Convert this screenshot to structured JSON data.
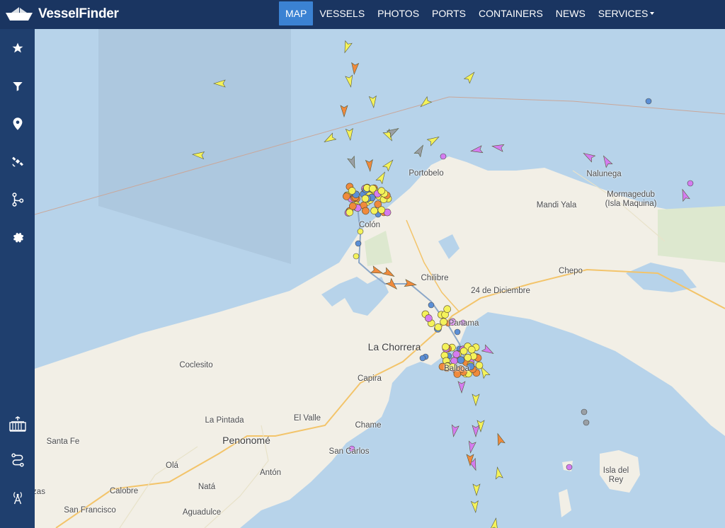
{
  "brand": {
    "name": "VesselFinder",
    "icon": "ship-logo-icon"
  },
  "nav": {
    "items": [
      {
        "label": "MAP",
        "active": true
      },
      {
        "label": "VESSELS"
      },
      {
        "label": "PHOTOS"
      },
      {
        "label": "PORTS"
      },
      {
        "label": "CONTAINERS"
      },
      {
        "label": "NEWS"
      },
      {
        "label": "SERVICES",
        "has_dropdown": true
      }
    ]
  },
  "sidebar": {
    "top": [
      "star-icon",
      "filter-icon",
      "location-pin-icon",
      "satellite-icon",
      "route-icon",
      "gear-icon"
    ],
    "bottom": [
      "container-icon",
      "voyage-route-icon",
      "antenna-icon"
    ]
  },
  "map": {
    "places": {
      "portobelo": "Portobelo",
      "nalunega": "Nalunega",
      "mormagedub_1": "Mormagedub",
      "mormagedub_2": "(Isla Maquina)",
      "mandi_yala": "Mandi Yala",
      "colon": "Colón",
      "chilibre": "Chilibre",
      "chepo": "Chepo",
      "diciembre": "24 de Diciembre",
      "panama": "Panama",
      "la_chorrera": "La Chorrera",
      "balboa": "Balboa",
      "coclesito": "Coclesito",
      "capira": "Capira",
      "la_pintada": "La Pintada",
      "el_valle": "El Valle",
      "chame": "Chame",
      "santa_fe": "Santa Fe",
      "penonome": "Penonomé",
      "san_carlos": "San Carlos",
      "ola": "Olá",
      "anton": "Antón",
      "calobre": "Calobre",
      "nata": "Natá",
      "san_francisco": "San Francisco",
      "aguadulce": "Aguadulce",
      "isla_del_rey_1": "Isla del",
      "isla_del_rey_2": "Rey",
      "edge_left": "zas"
    },
    "colors": {
      "sea": "#b7d3ea",
      "land": "#f2efe6",
      "cargo": "#f4f25a",
      "tanker": "#f08a3c",
      "passenger": "#5b8fd6",
      "pleasure": "#d47cf0",
      "other": "#9aa0a6"
    }
  }
}
